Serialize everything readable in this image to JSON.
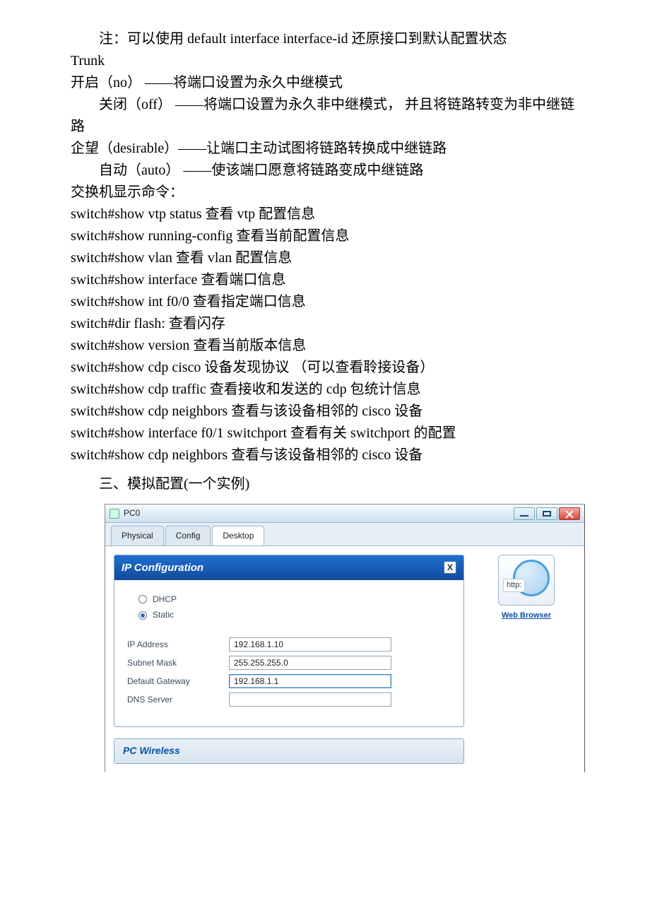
{
  "doc": {
    "p1": "注：可以使用 default interface interface-id            还原接口到默认配置状态",
    "p2": "Trunk",
    "p3": "开启（no）       ——将端口设置为永久中继模式",
    "p4": "关闭（off）      ——将端口设置为永久非中继模式， 并且将链路转变为非中继链路",
    "p5": "企望（desirable）——让端口主动试图将链路转换成中继链路",
    "p6": "自动（auto）    ——使该端口愿意将链路变成中继链路",
    "p7": "交换机显示命令：",
    "p8": "switch#show vtp status    查看 vtp 配置信息",
    "p9": "switch#show running-config    查看当前配置信息",
    "p10": "switch#show vlan    查看 vlan 配置信息",
    "p11": "switch#show interface    查看端口信息",
    "p12": "switch#show int f0/0    查看指定端口信息",
    "p13": "switch#dir flash:    查看闪存",
    "p14": "switch#show version    查看当前版本信息",
    "p15": "switch#show cdp    cisco 设备发现协议 （可以查看聆接设备）",
    "p16": "switch#show cdp traffic    查看接收和发送的 cdp 包统计信息",
    "p17": "switch#show cdp neighbors    查看与该设备相邻的 cisco 设备",
    "p18": "switch#show interface f0/1 switchport                              查看有关 switchport 的配置",
    "p19": "switch#show cdp neighbors                             查看与该设备相邻的 cisco 设备",
    "p20": "三、模拟配置(一个实例)"
  },
  "dialog": {
    "windowTitle": "PC0",
    "tabs": {
      "physical": "Physical",
      "config": "Config",
      "desktop": "Desktop"
    },
    "ipconfig": {
      "title": "IP Configuration",
      "closeX": "X",
      "dhcp": "DHCP",
      "static": "Static",
      "labels": {
        "ip": "IP Address",
        "mask": "Subnet Mask",
        "gw": "Default Gateway",
        "dns": "DNS Server"
      },
      "values": {
        "ip": "192.168.1.10",
        "mask": "255.255.255.0",
        "gw": "192.168.1.1",
        "dns": ""
      }
    },
    "pcwireless": "PC Wireless",
    "webbrowser": {
      "http": "http:",
      "label": "Web Browser"
    }
  }
}
